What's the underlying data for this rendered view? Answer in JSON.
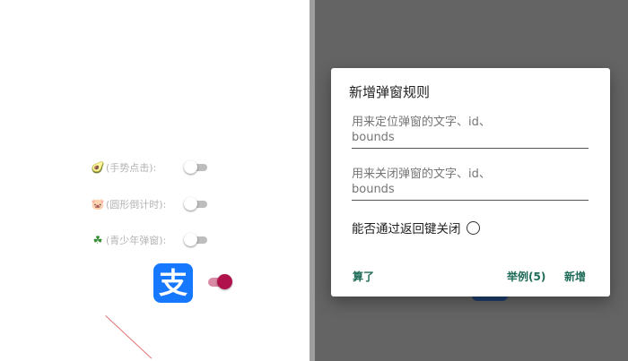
{
  "left": {
    "options": [
      {
        "icon": "🥑",
        "icon_name": "avocado-icon",
        "label": "(手势点击):",
        "enabled": false
      },
      {
        "icon": "🐷",
        "icon_name": "pig-icon",
        "label": "(圆形倒计时):",
        "enabled": false
      },
      {
        "icon": "☘",
        "icon_name": "shamrock-icon",
        "label": "(青少年弹窗):",
        "enabled": false
      }
    ],
    "app_icon_char": "支",
    "app_toggle_enabled": true,
    "colors": {
      "alipay": "#1677ff",
      "toggle_on": "#b0124c"
    }
  },
  "dialog": {
    "title": "新增弹窗规则",
    "locate_placeholder": "用来定位弹窗的文字、id、\nbounds",
    "close_placeholder": "用来关闭弹窗的文字、id、\nbounds",
    "back_close_label": "能否通过返回键关闭",
    "back_close_checked": false,
    "buttons": {
      "cancel": "算了",
      "example": "举例(5)",
      "add": "新增"
    },
    "colors": {
      "button_text": "#1e6b58"
    }
  }
}
